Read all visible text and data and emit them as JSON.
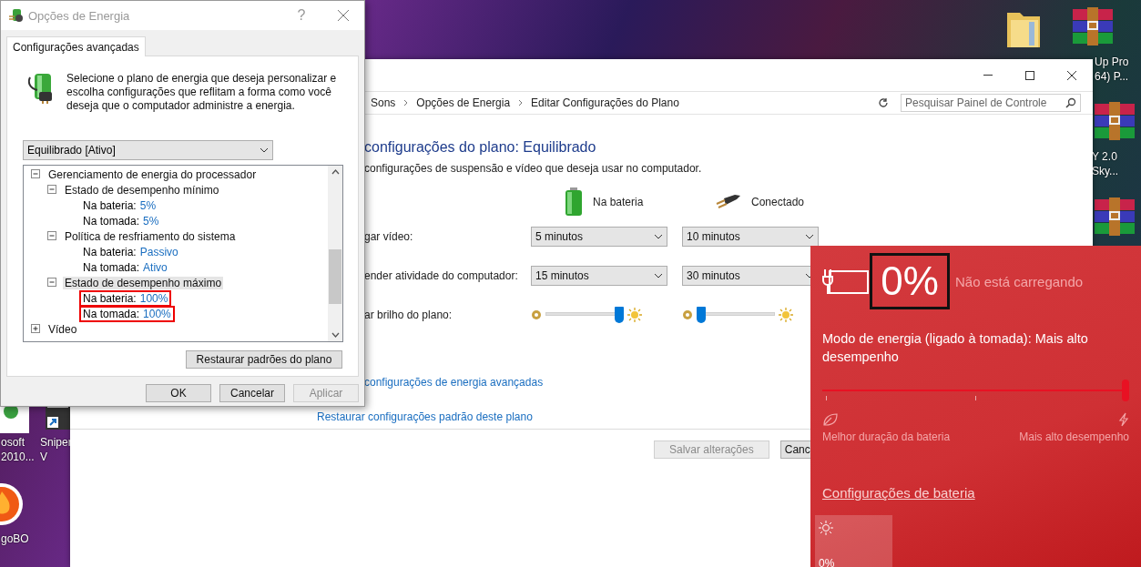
{
  "desktop_icons": [
    {
      "kind": "folder"
    },
    {
      "kind": "archive",
      "label_lines": [
        "Up Pro",
        "64) P..."
      ]
    },
    {
      "kind": "archive",
      "label_lines": [
        "Y 2.0",
        "Sky..."
      ]
    },
    {
      "kind": "archive"
    },
    {
      "kind": "app",
      "label_lines": [
        "osoft",
        "2010..."
      ]
    },
    {
      "kind": "shortcut",
      "label_lines": [
        "Sniper",
        "V"
      ]
    },
    {
      "kind": "flame",
      "label_lines": [
        "goBO"
      ]
    }
  ],
  "control_panel": {
    "breadcrumb": [
      "Sons",
      "Opções de Energia",
      "Editar Configurações do Plano"
    ],
    "search": {
      "placeholder": "Pesquisar Painel de Controle"
    },
    "title": "configurações do plano: Equilibrado",
    "subtitle": "configurações de suspensão e vídeo que deseja usar no computador.",
    "columns": [
      "Na bateria",
      "Conectado"
    ],
    "settings": [
      {
        "kind": "dropdown",
        "label": "gar vídeo:",
        "values": [
          "5 minutos",
          "10 minutos"
        ]
      },
      {
        "kind": "dropdown",
        "label": "ender atividade do computador:",
        "values": [
          "15 minutos",
          "30 minutos"
        ]
      },
      {
        "kind": "slider",
        "label": "ar brilho do plano:",
        "levels": [
          {
            "level": 1
          },
          {
            "level": 0
          }
        ]
      }
    ],
    "links": [
      "configurações de energia avançadas",
      "Restaurar configurações padrão deste plano"
    ],
    "buttons": [
      {
        "label": "Salvar alterações",
        "disabled": true
      },
      {
        "label": "Canc",
        "disabled": false
      }
    ]
  },
  "dialog": {
    "title": "Opções de Energia",
    "help": "?",
    "tabs": [
      {
        "label": "Configurações avançadas",
        "selected": true
      }
    ],
    "description": "Selecione o plano de energia que deseja personalizar e escolha configurações que reflitam a forma como você deseja que o computador administre a energia.",
    "plan": "Equilibrado [Ativo]",
    "tree": [
      {
        "label": "Gerenciamento de energia do processador",
        "expanded": true,
        "selected": false,
        "children": [
          {
            "label": "Estado de desempenho mínimo",
            "expanded": true,
            "selected": false,
            "children": [
              {
                "label": "Na bateria:",
                "value": "5%",
                "selected": false,
                "highlighted": false
              },
              {
                "label": "Na tomada:",
                "value": "5%",
                "selected": false,
                "highlighted": false
              }
            ]
          },
          {
            "label": "Política de resfriamento do sistema",
            "expanded": true,
            "selected": false,
            "children": [
              {
                "label": "Na bateria:",
                "value": "Passivo",
                "selected": false,
                "highlighted": false
              },
              {
                "label": "Na tomada:",
                "value": "Ativo",
                "selected": false,
                "highlighted": false
              }
            ]
          },
          {
            "label": "Estado de desempenho máximo",
            "expanded": true,
            "selected": true,
            "children": [
              {
                "label": "Na bateria:",
                "value": "100%",
                "selected": false,
                "highlighted": true
              },
              {
                "label": "Na tomada:",
                "value": "100%",
                "selected": false,
                "highlighted": true
              }
            ]
          }
        ]
      },
      {
        "label": "Vídeo",
        "expanded": false,
        "selected": false
      }
    ],
    "restore_button": "Restaurar padrões do plano",
    "buttons": [
      {
        "label": "OK",
        "disabled": false
      },
      {
        "label": "Cancelar",
        "disabled": false
      },
      {
        "label": "Aplicar",
        "disabled": true
      }
    ]
  },
  "battery_flyout": {
    "percent": "0%",
    "percent_outlined": true,
    "status": "Não está carregando",
    "mode_text": "Modo de energia (ligado à tomada): Mais alto desempenho",
    "mode_slider": {
      "level": 1
    },
    "left_label": "Melhor duração da bateria",
    "right_label": "Mais alto desempenho",
    "settings_link": "Configurações de bateria",
    "tiles": [
      {
        "value": "0%"
      }
    ]
  }
}
